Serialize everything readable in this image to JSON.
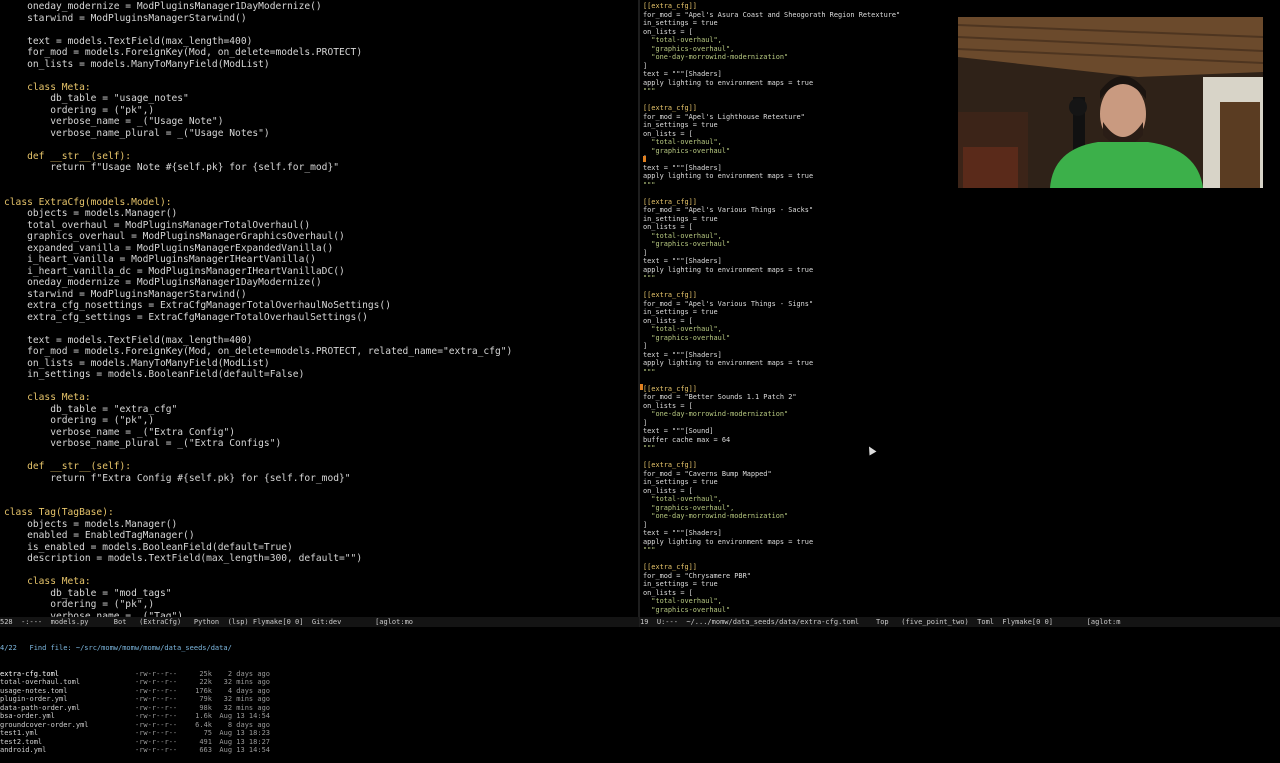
{
  "editor_left": {
    "lines": [
      "    oneday_modernize = ModPluginsManager1DayModernize()",
      "    starwind = ModPluginsManagerStarwind()",
      "",
      "    text = models.TextField(max_length=400)",
      "    for_mod = models.ForeignKey(Mod, on_delete=models.PROTECT)",
      "    on_lists = models.ManyToManyField(ModList)",
      "",
      "    class Meta:",
      "        db_table = \"usage_notes\"",
      "        ordering = (\"pk\",)",
      "        verbose_name = _(\"Usage Note\")",
      "        verbose_name_plural = _(\"Usage Notes\")",
      "",
      "    def __str__(self):",
      "        return f\"Usage Note #{self.pk} for {self.for_mod}\"",
      "",
      "",
      "class ExtraCfg(models.Model):",
      "    objects = models.Manager()",
      "    total_overhaul = ModPluginsManagerTotalOverhaul()",
      "    graphics_overhaul = ModPluginsManagerGraphicsOverhaul()",
      "    expanded_vanilla = ModPluginsManagerExpandedVanilla()",
      "    i_heart_vanilla = ModPluginsManagerIHeartVanilla()",
      "    i_heart_vanilla_dc = ModPluginsManagerIHeartVanillaDC()",
      "    oneday_modernize = ModPluginsManager1DayModernize()",
      "    starwind = ModPluginsManagerStarwind()",
      "    extra_cfg_nosettings = ExtraCfgManagerTotalOverhaulNoSettings()",
      "    extra_cfg_settings = ExtraCfgManagerTotalOverhaulSettings()",
      "",
      "    text = models.TextField(max_length=400)",
      "    for_mod = models.ForeignKey(Mod, on_delete=models.PROTECT, related_name=\"extra_cfg\")",
      "    on_lists = models.ManyToManyField(ModList)",
      "    in_settings = models.BooleanField(default=False)",
      "",
      "    class Meta:",
      "        db_table = \"extra_cfg\"",
      "        ordering = (\"pk\",)",
      "        verbose_name = _(\"Extra Config\")",
      "        verbose_name_plural = _(\"Extra Configs\")",
      "",
      "    def __str__(self):",
      "        return f\"Extra Config #{self.pk} for {self.for_mod}\"",
      "",
      "",
      "class Tag(TagBase):",
      "    objects = models.Manager()",
      "    enabled = EnabledTagManager()",
      "    is_enabled = models.BooleanField(default=True)",
      "    description = models.TextField(max_length=300, default=\"\")",
      "",
      "    class Meta:",
      "        db_table = \"mod_tags\"",
      "        ordering = (\"pk\",)",
      "        verbose_name = _(\"Tag\")"
    ],
    "modeline": "528  -:---  models.py      Bot   (ExtraCfg)   Python  (lsp) Flymake[0 0]  Git:dev        [aglot:mo"
  },
  "editor_right": {
    "lines": [
      "[[extra_cfg]]",
      "for_mod = \"Apel's Asura Coast and Sheogorath Region Retexture\"",
      "in_settings = true",
      "on_lists = [",
      "  \"total-overhaul\",",
      "  \"graphics-overhaul\",",
      "  \"one-day-morrowind-modernization\"",
      "]",
      "text = \"\"\"[Shaders]",
      "apply lighting to environment maps = true",
      "\"\"\"",
      "",
      "[[extra_cfg]]",
      "for_mod = \"Apel's Lighthouse Retexture\"",
      "in_settings = true",
      "on_lists = [",
      "  \"total-overhaul\",",
      "  \"graphics-overhaul\"",
      "]",
      "text = \"\"\"[Shaders]",
      "apply lighting to environment maps = true",
      "\"\"\"",
      "",
      "[[extra_cfg]]",
      "for_mod = \"Apel's Various Things - Sacks\"",
      "in_settings = true",
      "on_lists = [",
      "  \"total-overhaul\",",
      "  \"graphics-overhaul\"",
      "]",
      "text = \"\"\"[Shaders]",
      "apply lighting to environment maps = true",
      "\"\"\"",
      "",
      "[[extra_cfg]]",
      "for_mod = \"Apel's Various Things - Signs\"",
      "in_settings = true",
      "on_lists = [",
      "  \"total-overhaul\",",
      "  \"graphics-overhaul\"",
      "]",
      "text = \"\"\"[Shaders]",
      "apply lighting to environment maps = true",
      "\"\"\"",
      "",
      "[[extra_cfg]]",
      "for_mod = \"Better Sounds 1.1 Patch 2\"",
      "on_lists = [",
      "  \"one-day-morrowind-modernization\"",
      "]",
      "text = \"\"\"[Sound]",
      "buffer cache max = 64",
      "\"\"\"",
      "",
      "[[extra_cfg]]",
      "for_mod = \"Caverns Bump Mapped\"",
      "in_settings = true",
      "on_lists = [",
      "  \"total-overhaul\",",
      "  \"graphics-overhaul\",",
      "  \"one-day-morrowind-modernization\"",
      "]",
      "text = \"\"\"[Shaders]",
      "apply lighting to environment maps = true",
      "\"\"\"",
      "",
      "[[extra_cfg]]",
      "for_mod = \"Chrysamere PBR\"",
      "in_settings = true",
      "on_lists = [",
      "  \"total-overhaul\",",
      "  \"graphics-overhaul\""
    ],
    "modeline": "19  U:---  ~/.../momw/data_seeds/data/extra-cfg.toml    Top   (five_point_two)  Toml  Flymake[0 0]        [aglot:m"
  },
  "minibuffer": {
    "prompt": "4/22   Find file: ~/src/momw/momw/momw/data_seeds/data/",
    "files": [
      {
        "name": "extra-cfg.toml",
        "perms": "-rw-r--r--",
        "size": "25k",
        "time": "2 days ago"
      },
      {
        "name": "total-overhaul.toml",
        "perms": "-rw-r--r--",
        "size": "22k",
        "time": "32 mins ago"
      },
      {
        "name": "usage-notes.toml",
        "perms": "-rw-r--r--",
        "size": "176k",
        "time": "4 days ago"
      },
      {
        "name": "plugin-order.yml",
        "perms": "-rw-r--r--",
        "size": "79k",
        "time": "32 mins ago"
      },
      {
        "name": "data-path-order.yml",
        "perms": "-rw-r--r--",
        "size": "98k",
        "time": "32 mins ago"
      },
      {
        "name": "bsa-order.yml",
        "perms": "-rw-r--r--",
        "size": "1.6k",
        "time": "Aug 13 14:54"
      },
      {
        "name": "groundcover-order.yml",
        "perms": "-rw-r--r--",
        "size": "6.4k",
        "time": "8 days ago"
      },
      {
        "name": "test1.yml",
        "perms": "-rw-r--r--",
        "size": "75",
        "time": "Aug 13 18:23"
      },
      {
        "name": "test2.toml",
        "perms": "-rw-r--r--",
        "size": "491",
        "time": "Aug 13 18:27"
      },
      {
        "name": "android.yml",
        "perms": "-rw-r--r--",
        "size": "663",
        "time": "Aug 13 14:54"
      }
    ]
  }
}
